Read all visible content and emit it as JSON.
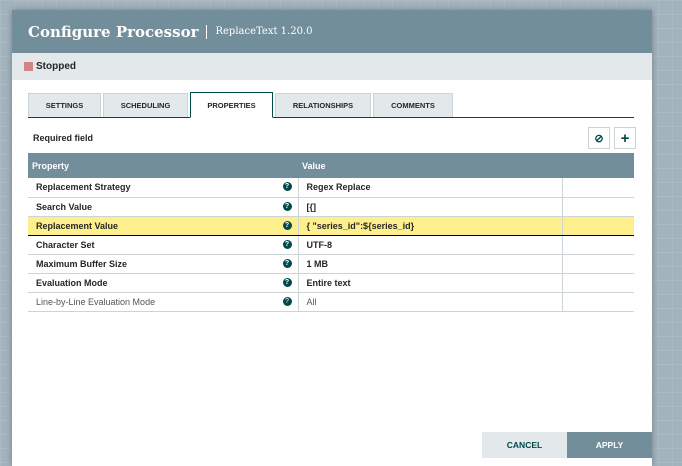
{
  "header": {
    "title": "Configure Processor",
    "subtitle": "ReplaceText 1.20.0"
  },
  "status": {
    "label": "Stopped",
    "color": "#d18686"
  },
  "tabs": [
    {
      "label": "SETTINGS"
    },
    {
      "label": "SCHEDULING"
    },
    {
      "label": "PROPERTIES",
      "active": true
    },
    {
      "label": "RELATIONSHIPS"
    },
    {
      "label": "COMMENTS"
    }
  ],
  "required_label": "Required field",
  "table": {
    "headers": [
      "Property",
      "Value"
    ],
    "rows": [
      {
        "property": "Replacement Strategy",
        "value": "Regex Replace"
      },
      {
        "property": "Search Value",
        "value": "[{]"
      },
      {
        "property": "Replacement Value",
        "value": "{ \"series_id\":${series_id}",
        "selected": true
      },
      {
        "property": "Character Set",
        "value": "UTF-8"
      },
      {
        "property": "Maximum Buffer Size",
        "value": "1 MB"
      },
      {
        "property": "Evaluation Mode",
        "value": "Entire text"
      },
      {
        "property": "Line-by-Line Evaluation Mode",
        "value": "All",
        "optional": true
      }
    ]
  },
  "buttons": {
    "cancel": "CANCEL",
    "apply": "APPLY"
  }
}
